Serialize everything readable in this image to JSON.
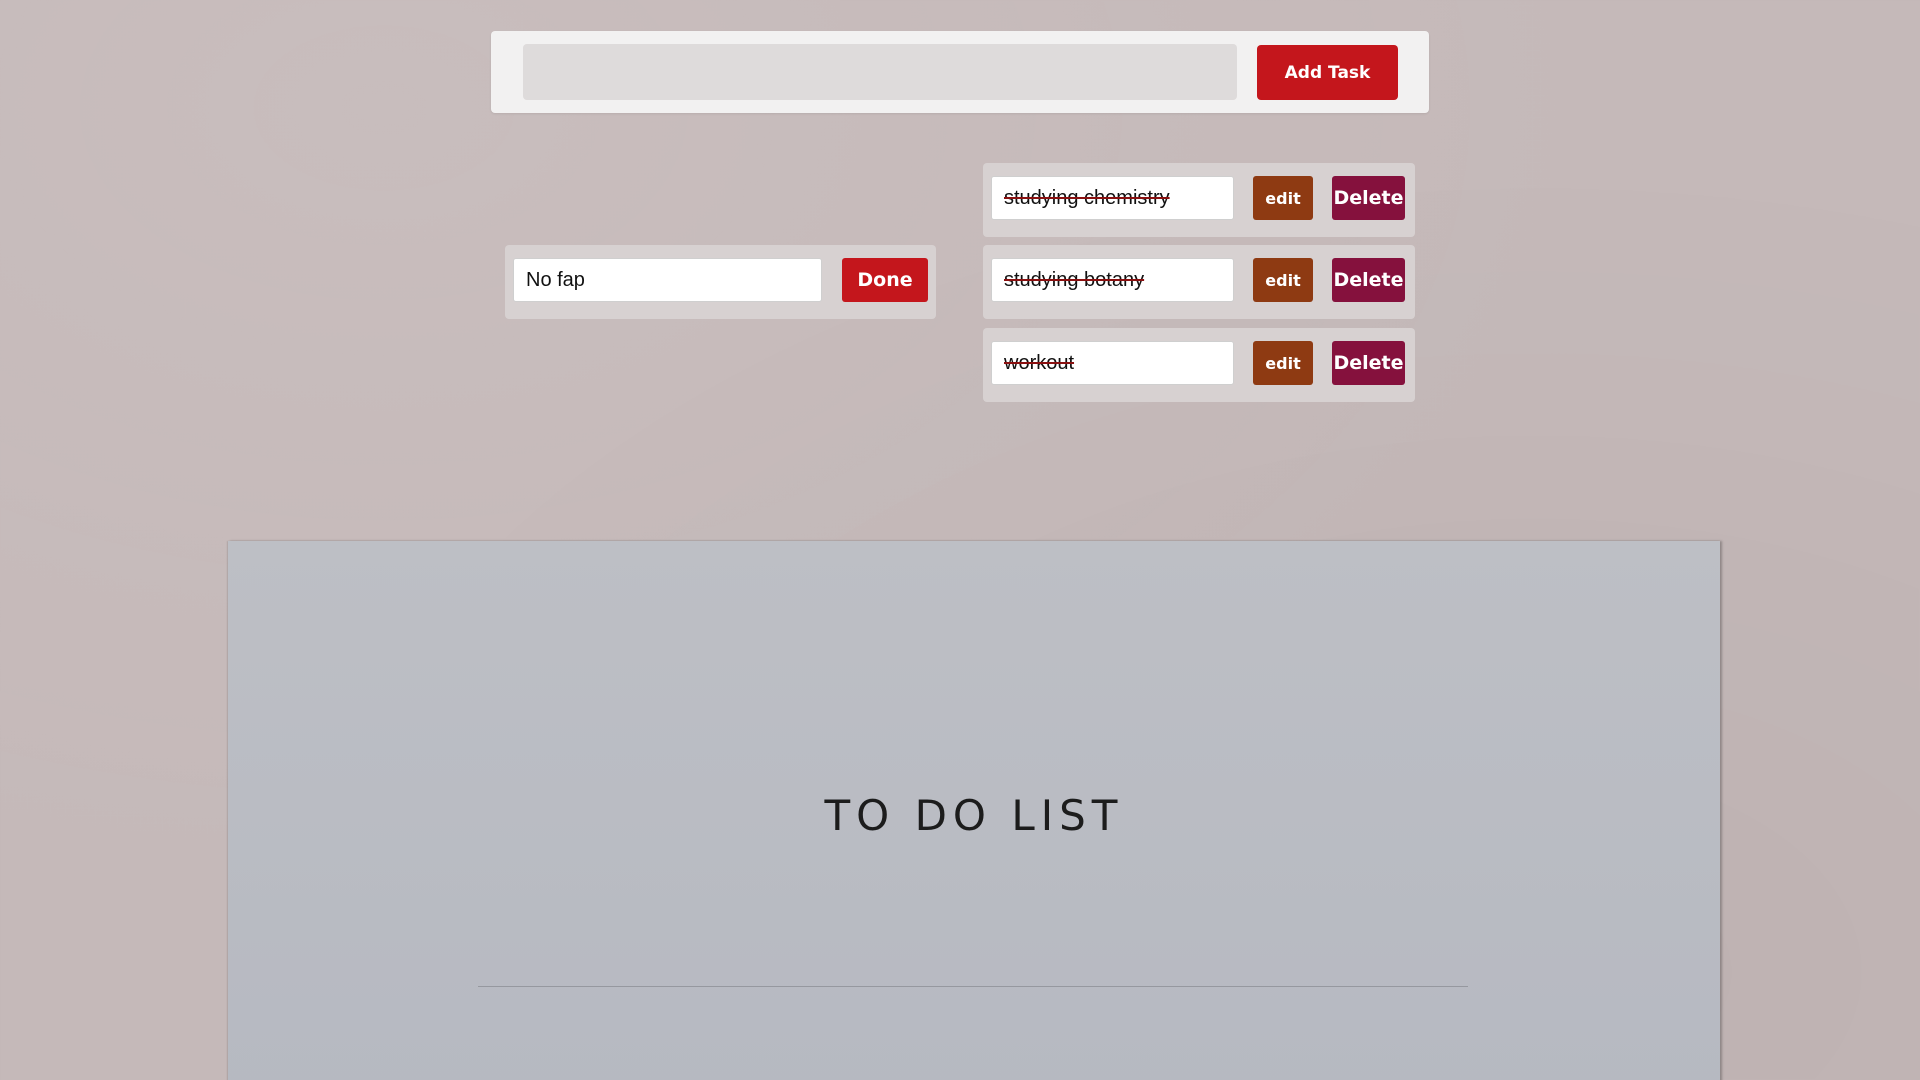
{
  "add_task": {
    "input_value": "",
    "button_label": "Add Task"
  },
  "pending_tasks": [
    {
      "text": "No fap",
      "done_label": "Done"
    }
  ],
  "completed_tasks": [
    {
      "text": "studying chemistry",
      "edit_label": "edit",
      "delete_label": "Delete"
    },
    {
      "text": "studying botany",
      "edit_label": "edit",
      "delete_label": "Delete"
    },
    {
      "text": "workout",
      "edit_label": "edit",
      "delete_label": "Delete"
    }
  ],
  "background": {
    "paper_title": "TO DO LIST"
  },
  "colors": {
    "page_background": "#c5b9b9",
    "add_button": "#c4161c",
    "done_button": "#c4161c",
    "edit_button": "#8e3a12",
    "delete_button": "#85113d",
    "strikethrough": "#8a1010"
  }
}
